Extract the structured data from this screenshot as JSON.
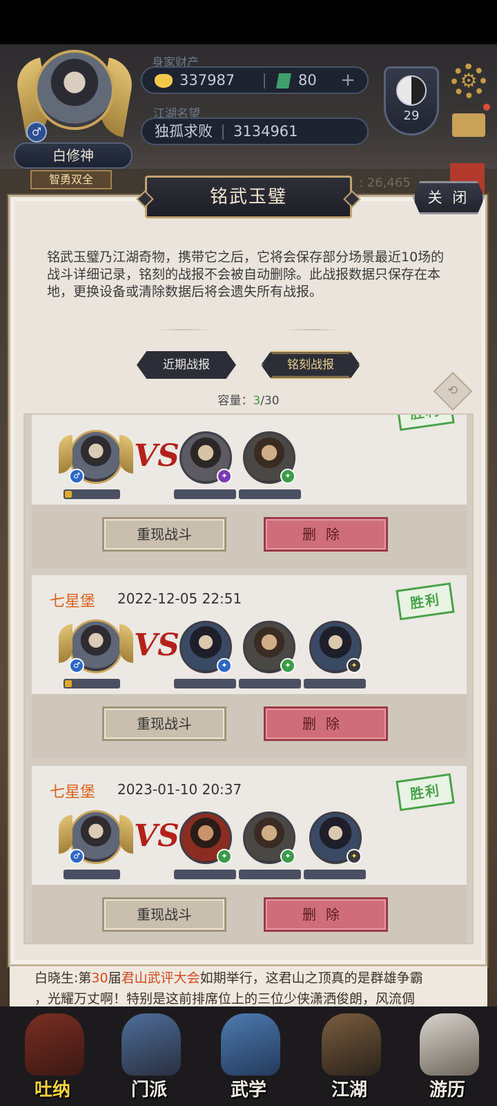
{
  "hud": {
    "wealth_label": "身家财产",
    "gold": "337987",
    "jade": "80",
    "plus": "+",
    "fame_label": "江湖名望",
    "fame_title": "独孤求败",
    "fame_value": "3134961",
    "player_name": "白修神",
    "player_title": "智勇双全",
    "gender_symbol": "♂",
    "level": "29",
    "power_text": ": 26,465"
  },
  "panel": {
    "title": "铭武玉璧",
    "close_label": "关 闭",
    "description": "铭武玉璧乃江湖奇物，携带它之后，它将会保存部分场景最近10场的战斗详细记录，铭刻的战报不会被自动删除。此战报数据只保存在本地，更换设备或清除数据后将会遗失所有战报。",
    "tabs": [
      {
        "label": "近期战报",
        "active": false
      },
      {
        "label": "铭刻战报",
        "active": true
      }
    ],
    "capacity_label": "容量：",
    "capacity_current": "3",
    "capacity_max": "/30"
  },
  "records": [
    {
      "place": "",
      "time": "",
      "result": "胜利",
      "player_hp": 0.1,
      "enemies": [
        "purple",
        "green"
      ],
      "replay_label": "重现战斗",
      "delete_label": "删除"
    },
    {
      "place": "七星堡",
      "time": "2022-12-05 22:51",
      "result": "胜利",
      "player_hp": 0.1,
      "enemies": [
        "blue",
        "green",
        "dark"
      ],
      "replay_label": "重现战斗",
      "delete_label": "删除"
    },
    {
      "place": "七星堡",
      "time": "2023-01-10 20:37",
      "result": "胜利",
      "player_hp": 0,
      "enemies": [
        "green",
        "green",
        "dark"
      ],
      "replay_label": "重现战斗",
      "delete_label": "删除"
    }
  ],
  "vs_text": "VS",
  "chat": {
    "line1_a": "白晓生:第",
    "line1_num": "30",
    "line1_b": "届",
    "line1_event": "君山武评大会",
    "line1_c": "如期举行，这君山之顶真的是群雄争霸",
    "line2": "，光耀万丈啊！特别是这前排席位上的三位少侠潇洒俊朗，风流倜"
  },
  "nav": [
    {
      "label": "吐纳",
      "active": true
    },
    {
      "label": "门派",
      "active": false
    },
    {
      "label": "武学",
      "active": false
    },
    {
      "label": "江湖",
      "active": false
    },
    {
      "label": "游历",
      "active": false
    }
  ],
  "colors": {
    "accent_gold": "#c9a55a",
    "place_orange": "#d9621e",
    "win_green": "#4aa24a",
    "delete_red": "#cf6e7a",
    "capacity_green": "#3c9a3c"
  },
  "icons": [
    "gold-ingot-icon",
    "jade-icon",
    "yinyang-icon",
    "gear-icon",
    "mail-icon",
    "refresh-icon",
    "gender-male-icon"
  ]
}
